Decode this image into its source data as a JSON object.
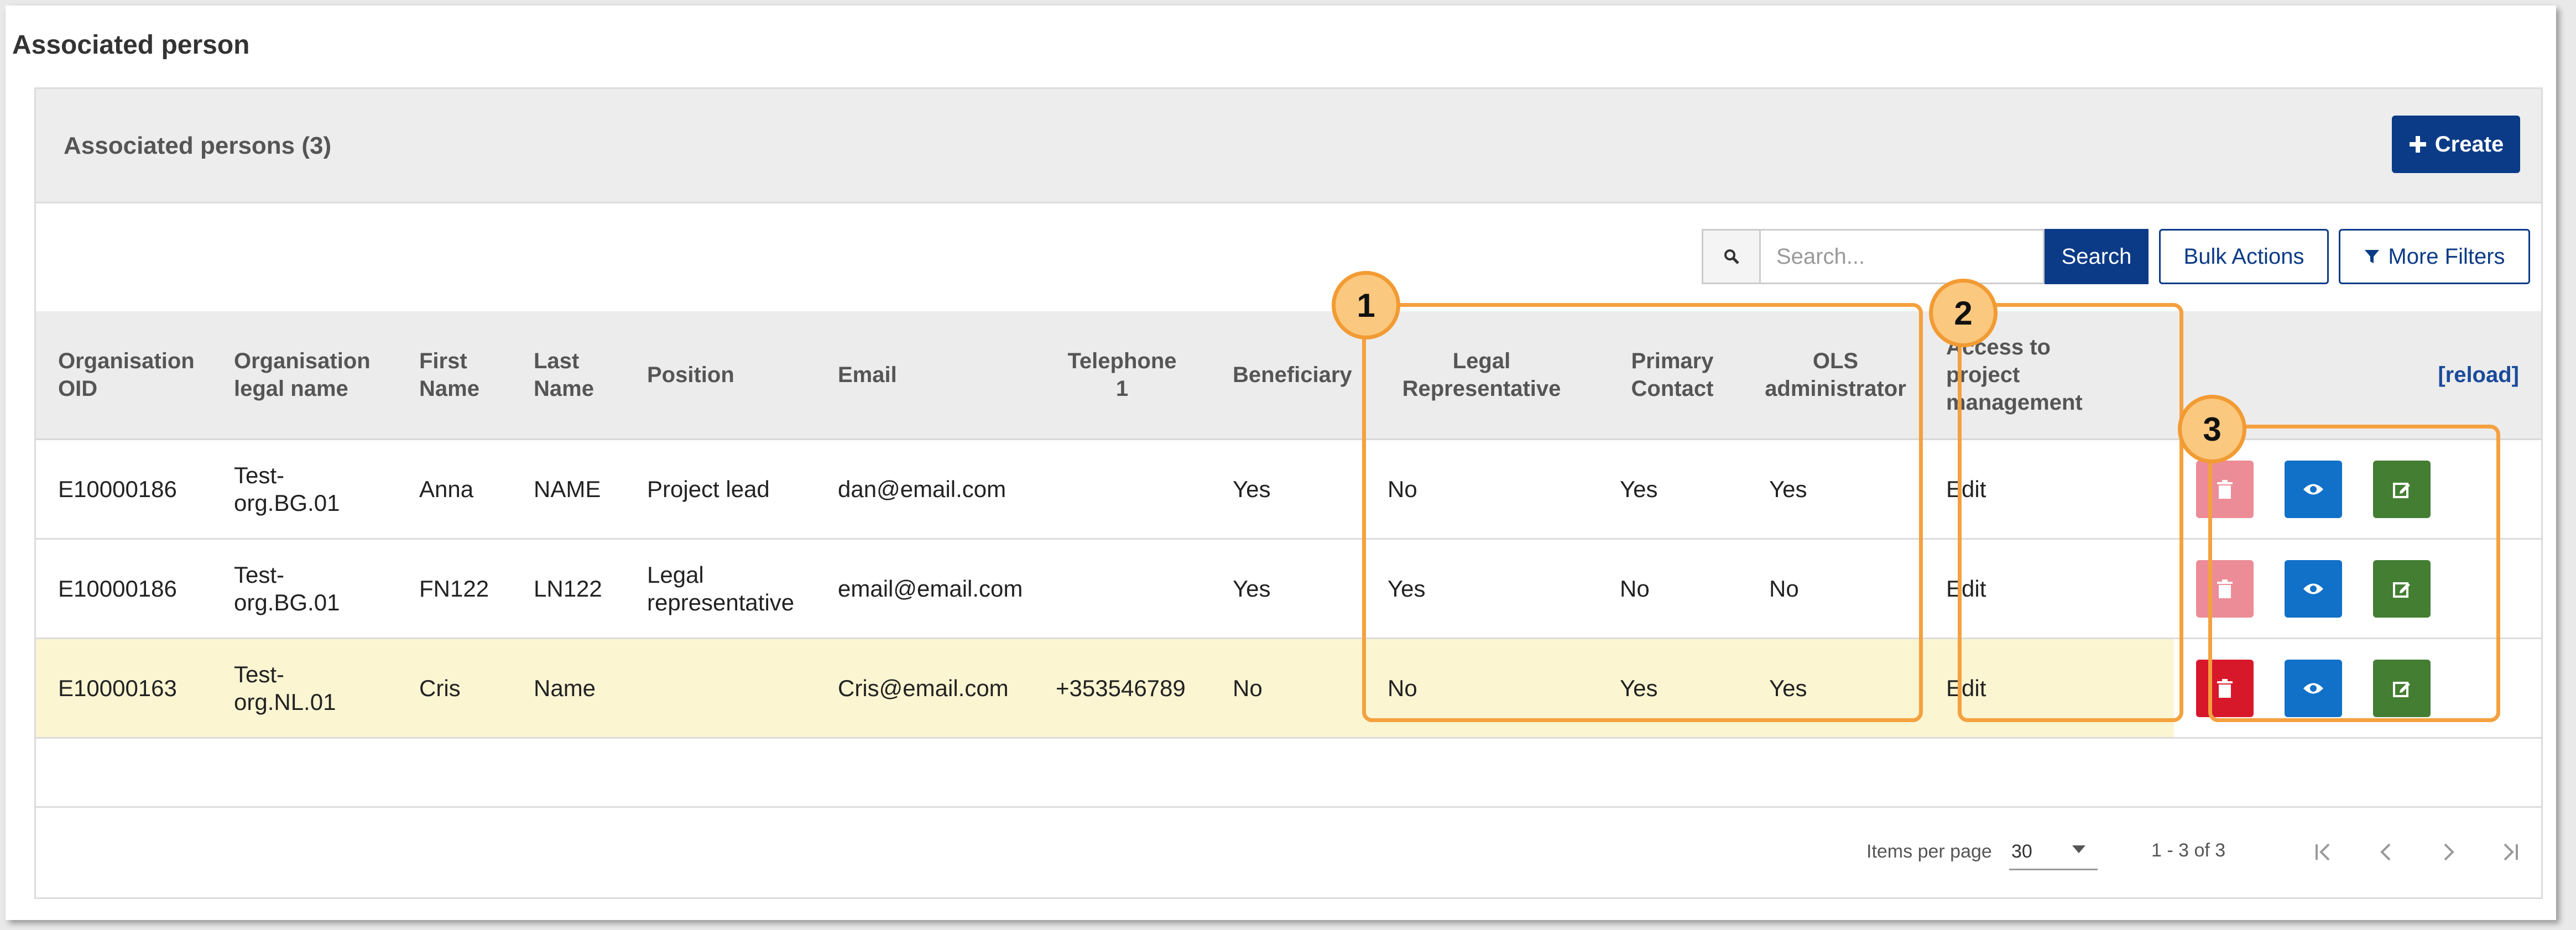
{
  "page": {
    "title": "Associated person"
  },
  "card": {
    "title": "Associated persons (3)",
    "create_label": "Create"
  },
  "toolbar": {
    "search_placeholder": "Search...",
    "search_label": "Search",
    "bulk_actions_label": "Bulk Actions",
    "more_filters_label": "More Filters"
  },
  "table": {
    "headers": {
      "org_oid": [
        "Organisation",
        "OID"
      ],
      "org_name": [
        "Organisation",
        "legal name"
      ],
      "first_name": [
        "First",
        "Name"
      ],
      "last_name": [
        "Last",
        "Name"
      ],
      "position": "Position",
      "email": "Email",
      "telephone": [
        "Telephone",
        "1"
      ],
      "beneficiary": "Beneficiary",
      "legal_rep": [
        "Legal",
        "Representative"
      ],
      "primary_contact": [
        "Primary",
        "Contact"
      ],
      "ols_admin": [
        "OLS",
        "administrator"
      ],
      "access": [
        "Access to",
        "project",
        "management"
      ],
      "reload": "[reload]"
    },
    "rows": [
      {
        "org_oid": "E10000186",
        "org_name": [
          "Test-",
          "org.BG.01"
        ],
        "first_name": "Anna",
        "last_name": "NAME",
        "position": [
          "Project lead"
        ],
        "email": "dan@email.com",
        "telephone": "",
        "beneficiary": "Yes",
        "legal_rep": "No",
        "primary_contact": "Yes",
        "ols_admin": "Yes",
        "access": "Edit",
        "delete_enabled": false
      },
      {
        "org_oid": "E10000186",
        "org_name": [
          "Test-",
          "org.BG.01"
        ],
        "first_name": "FN122",
        "last_name": "LN122",
        "position": [
          "Legal",
          "representative"
        ],
        "email": "email@email.com",
        "telephone": "",
        "beneficiary": "Yes",
        "legal_rep": "Yes",
        "primary_contact": "No",
        "ols_admin": "No",
        "access": "Edit",
        "delete_enabled": false
      },
      {
        "org_oid": "E10000163",
        "org_name": [
          "Test-",
          "org.NL.01"
        ],
        "first_name": "Cris",
        "last_name": "Name",
        "position": [],
        "email": "Cris@email.com",
        "telephone": "+353546789",
        "beneficiary": "No",
        "legal_rep": "No",
        "primary_contact": "Yes",
        "ols_admin": "Yes",
        "access": "Edit",
        "delete_enabled": true
      }
    ]
  },
  "pagination": {
    "items_per_page_label": "Items per page",
    "items_per_page": "30",
    "range": "1 - 3 of 3"
  },
  "callouts": [
    "1",
    "2",
    "3"
  ],
  "icons": {
    "search": "search-icon",
    "create": "plus-icon",
    "filter": "filter-icon",
    "delete": "trash-icon",
    "view": "eye-icon",
    "edit": "edit-icon",
    "first": "first-page-icon",
    "prev": "chevron-left-icon",
    "next": "chevron-right-icon",
    "last": "last-page-icon"
  },
  "colors": {
    "primary": "#0b3a87",
    "delete_disabled": "#ec8c96",
    "delete": "#d7182a",
    "view": "#1170c7",
    "edit": "#437e32",
    "row_highlight": "#fbf5d2",
    "callout": "#f5a13f"
  }
}
